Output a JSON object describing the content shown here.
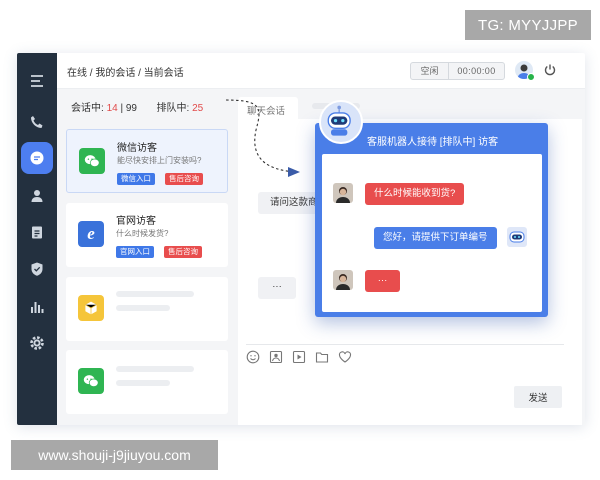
{
  "badge_text": "TG: MYYJJPP",
  "watermark_text": "www.shouji-j9jiuyou.com",
  "breadcrumb": "在线 / 我的会话 / 当前会话",
  "status": {
    "idle": "空闲",
    "timer": "00:00:00"
  },
  "counts": {
    "in_session_label": "会话中:",
    "in_session_current": "14",
    "in_session_total": "99",
    "queue_label": "排队中:",
    "queue_value": "25"
  },
  "cards": [
    {
      "title": "微信访客",
      "subtitle": "能尽快安排上门安装吗?",
      "tags": [
        "微信入口",
        "售后咨询"
      ],
      "icon": "wechat-icon",
      "color": "#2fb552"
    },
    {
      "title": "官网访客",
      "subtitle": "什么时候发货?",
      "tags": [
        "官网入口",
        "售后咨询"
      ],
      "icon": "ie-icon",
      "color": "#3a72da"
    },
    {
      "icon": "box-icon",
      "color": "#f5c53a"
    },
    {
      "icon": "wechat-icon",
      "color": "#2fb552"
    }
  ],
  "chat": {
    "tab_label": "聊天会话",
    "bubble_1": "请问这款商",
    "bubble_2": "···",
    "send_label": "发送"
  },
  "robot": {
    "title": "客服机器人接待 [排队中] 访客",
    "msg_1": "什么时候能收到货?",
    "msg_2": "您好，请提供下订单编号",
    "msg_3": "···"
  },
  "colors": {
    "sidebar": "#23303f",
    "accent": "#4d7ef0",
    "red": "#e84d4d",
    "wechat": "#2fb552"
  }
}
